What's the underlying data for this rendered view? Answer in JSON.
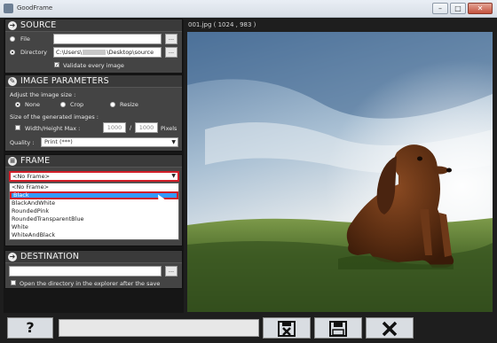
{
  "window": {
    "title": "GoodFrame",
    "min": "–",
    "max": "□",
    "close": "✕"
  },
  "source": {
    "title": "SOURCE",
    "file_label": "File",
    "file_value": "",
    "dir_label": "Directory",
    "dir_prefix": "C:\\Users\\",
    "dir_suffix": "\\Desktop\\source",
    "browse": "...",
    "validate_label": "Validate every image",
    "validate_checked": "✓",
    "selected": "directory"
  },
  "params": {
    "title": "IMAGE PARAMETERS",
    "adjust_label": "Adjust the image size :",
    "opt_none": "None",
    "opt_crop": "Crop",
    "opt_resize": "Resize",
    "size_label": "Size of the generated images :",
    "wh_label": "Width/Height Max :",
    "width": "1000",
    "height": "1000",
    "slash": "/",
    "units": "Pixels",
    "quality_label": "Quality :",
    "quality_value": "Print (***)"
  },
  "frame": {
    "title": "FRAME",
    "selected": "<No Frame>",
    "options": [
      "<No Frame>",
      "Black",
      "BlackAndWhite",
      "RoundedPink",
      "RoundedTransparentBlue",
      "White",
      "WhiteAndBlack"
    ],
    "highlighted": "Black"
  },
  "destination": {
    "title": "DESTINATION",
    "path": "",
    "browse": "...",
    "open_label": "Open the directory in the explorer after the save"
  },
  "image": {
    "caption": "001.jpg ( 1024 , 983 )"
  },
  "bottom": {
    "help": "?",
    "progress": 0
  },
  "icons": {
    "source": "arrow-circle-icon",
    "params": "wrench-icon",
    "frame": "menu-icon",
    "dest": "arrow-circle-icon",
    "cancel_save": "cancel-save-icon",
    "save": "floppy-disk-icon",
    "close": "x-icon"
  }
}
